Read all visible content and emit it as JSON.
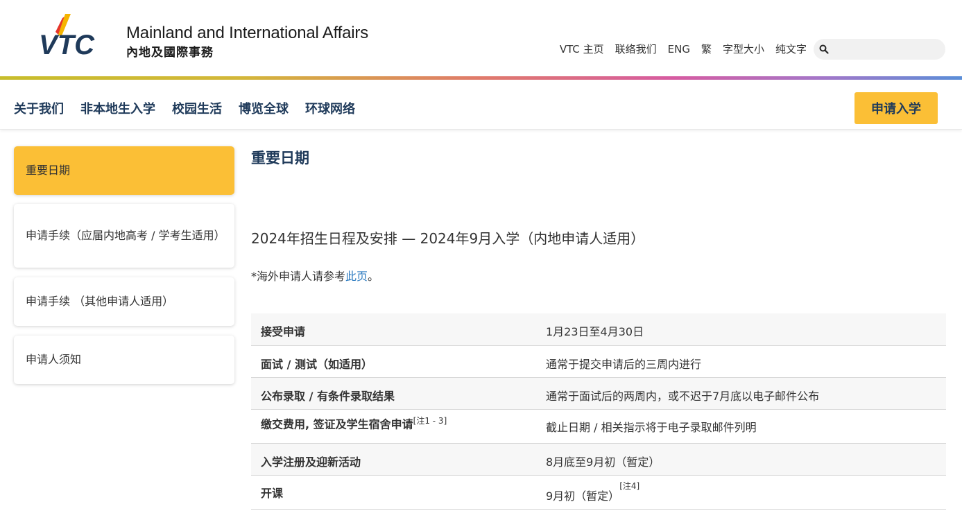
{
  "header": {
    "logo_text": "VTC",
    "brand_en": "Mainland and International Affairs",
    "brand_zh": "內地及國際事務",
    "util_links": [
      "VTC 主页",
      "联络我们",
      "ENG",
      "繁",
      "字型大小",
      "纯文字"
    ],
    "search": {
      "placeholder": "",
      "icon": "search-icon"
    }
  },
  "nav": {
    "items": [
      "关于我们",
      "非本地生入学",
      "校园生活",
      "博览全球",
      "环球网络"
    ],
    "apply_label": "申请入学"
  },
  "sidebar": {
    "items": [
      {
        "label": "重要日期",
        "active": true
      },
      {
        "label": "申请手续（应届内地高考 / 学考生适用）",
        "active": false
      },
      {
        "label": "申请手续 （其他申请人适用）",
        "active": false
      },
      {
        "label": "申请人须知",
        "active": false
      }
    ]
  },
  "main": {
    "title": "重要日期",
    "section_title": "2024年招生日程及安排 — 2024年9月入学（内地申请人适用）",
    "note_prefix": "*海外申请人请参考",
    "note_link": "此页",
    "note_suffix": "。",
    "rows": [
      {
        "label": "接受申请",
        "label_sup": "",
        "value": "1月23日至4月30日",
        "value_sup": ""
      },
      {
        "label": "面试 / 测试（如适用）",
        "label_sup": "",
        "value": "通常于提交申请后的三周内进行",
        "value_sup": ""
      },
      {
        "label": "公布录取 / 有条件录取结果",
        "label_sup": "",
        "value": "通常于面试后的两周内，或不迟于7月底以电子邮件公布",
        "value_sup": ""
      },
      {
        "label": "缴交费用, 签证及学生宿舍申请",
        "label_sup": "[注1 - 3]",
        "value": "截止日期 / 相关指示将于电子录取邮件列明",
        "value_sup": ""
      },
      {
        "label": "入学注册及迎新活动",
        "label_sup": "",
        "value": "8月底至9月初（暂定）",
        "value_sup": ""
      },
      {
        "label": "开课",
        "label_sup": "",
        "value": "9月初（暂定）",
        "value_sup": "[注4]"
      }
    ]
  },
  "colors": {
    "accent_yellow": "#fbbf36",
    "nav_text": "#1f3a5a",
    "link_blue": "#2a7ac0",
    "logo_blue": "#1f3a5a",
    "logo_red": "#e5352c",
    "logo_yellow": "#f5b400"
  }
}
